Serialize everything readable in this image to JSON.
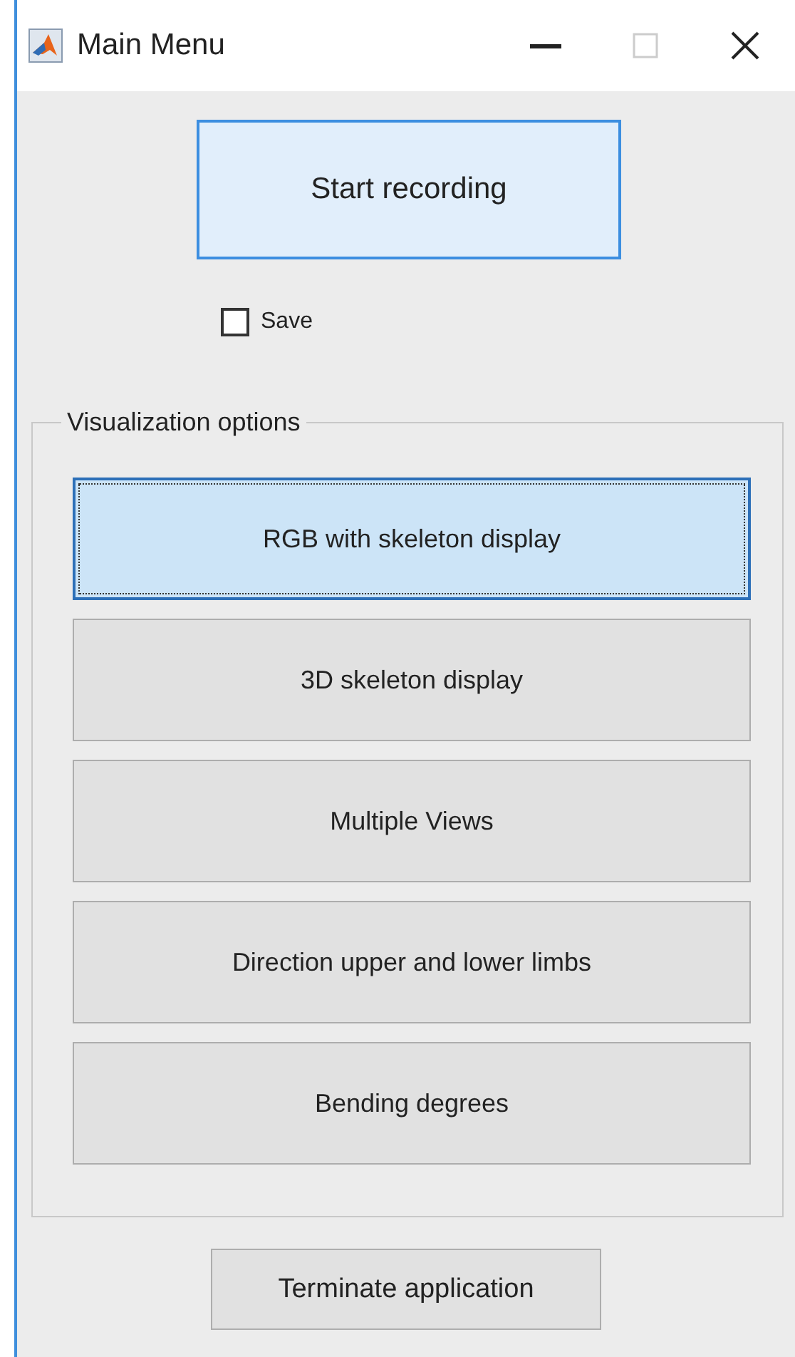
{
  "window": {
    "title": "Main Menu",
    "maximize_disabled": true
  },
  "start_button": {
    "label": "Start recording",
    "hovered": true
  },
  "save_checkbox": {
    "label": "Save",
    "checked": false
  },
  "visualization": {
    "title": "Visualization options",
    "options": [
      {
        "label": "RGB with skeleton display",
        "selected": true
      },
      {
        "label": "3D skeleton display",
        "selected": false
      },
      {
        "label": "Multiple Views",
        "selected": false
      },
      {
        "label": "Direction upper and lower limbs",
        "selected": false
      },
      {
        "label": "Bending degrees",
        "selected": false
      }
    ]
  },
  "terminate_button": {
    "label": "Terminate application"
  }
}
